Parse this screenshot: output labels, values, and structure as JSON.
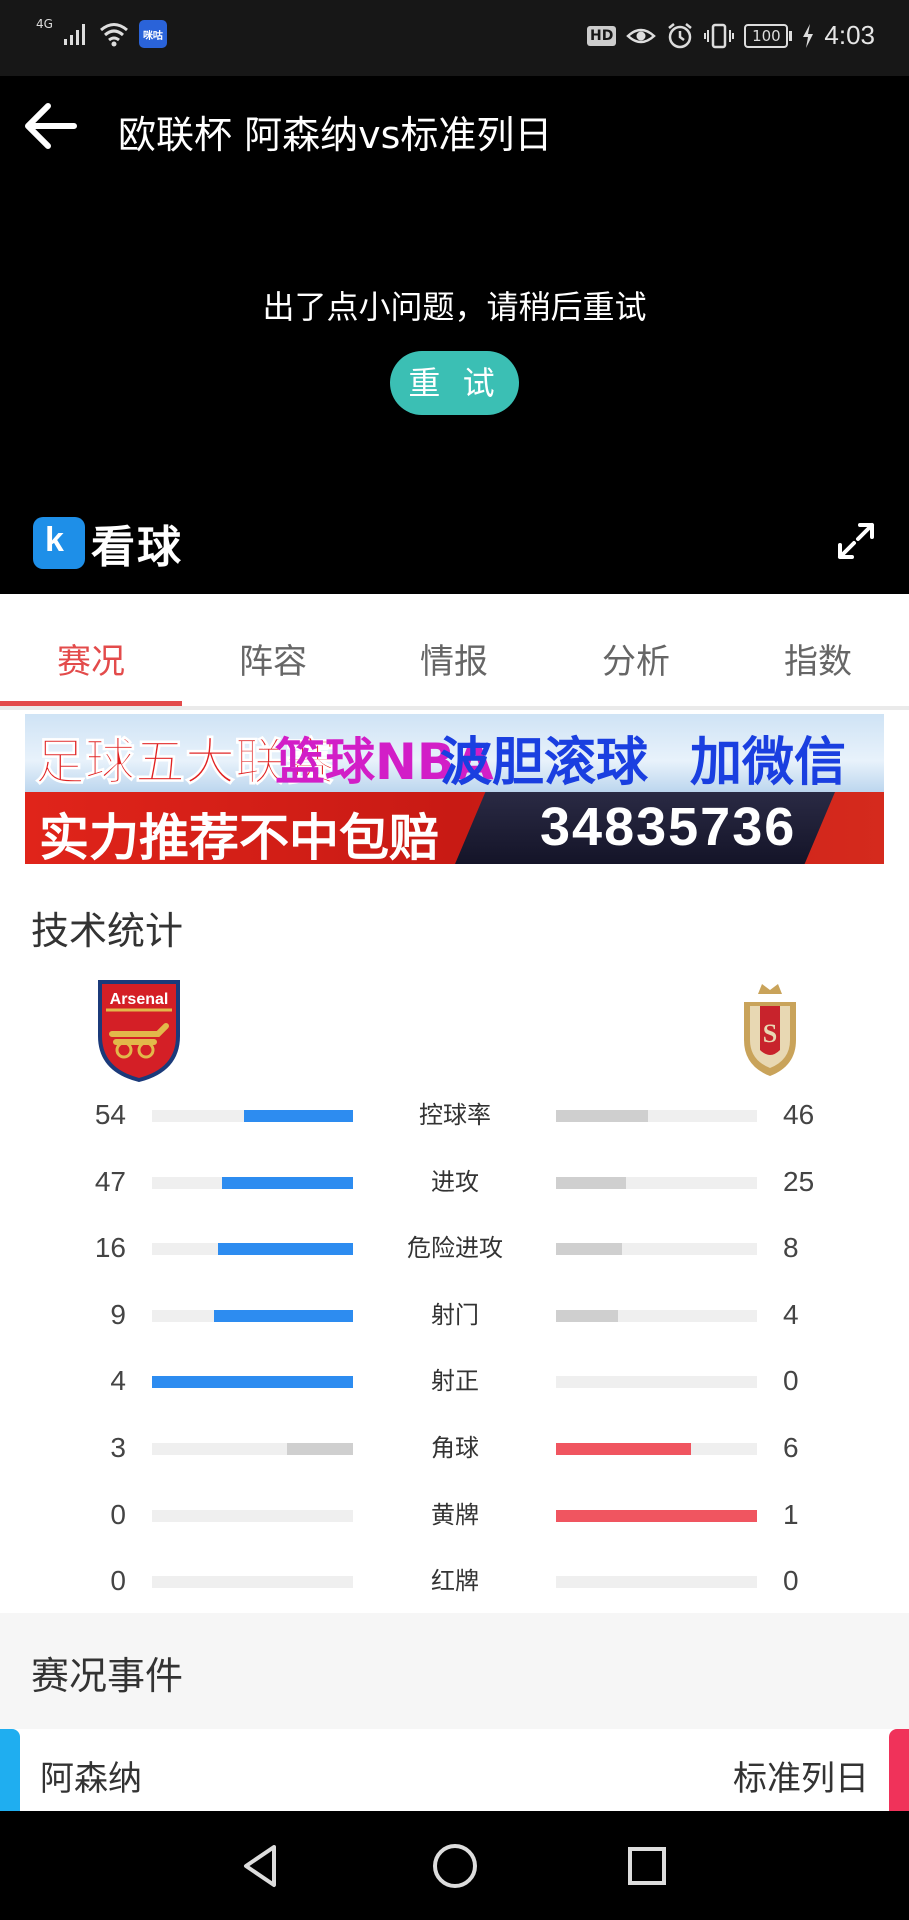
{
  "status_bar": {
    "network_label": "4G",
    "app_badge_text": "咪咕",
    "hd_label": "HD",
    "battery": "100",
    "time": "4:03",
    "icons": [
      "signal-icon",
      "wifi-icon",
      "eye-comfort-icon",
      "alarm-icon",
      "vibrate-icon",
      "battery-icon",
      "charging-icon"
    ]
  },
  "header": {
    "title": "欧联杯 阿森纳vs标准列日"
  },
  "player": {
    "error_message": "出了点小问题，请稍后重试",
    "retry_label": "重 试",
    "logo_text": "看球",
    "retry_color": "#3bbfb4"
  },
  "tabs": [
    {
      "label": "赛况",
      "active": true
    },
    {
      "label": "阵容",
      "active": false
    },
    {
      "label": "情报",
      "active": false
    },
    {
      "label": "分析",
      "active": false
    },
    {
      "label": "指数",
      "active": false
    }
  ],
  "banner": {
    "line1_a": "足球五大联赛",
    "line1_b": "篮球NBA",
    "line1_c": "波胆滚球",
    "line1_d": "加微信",
    "line2_a": "实力推荐不中包赔",
    "line2_b": "34835736"
  },
  "stats": {
    "title": "技术统计",
    "home_color": "#2d8cf0",
    "away_color": "#f05560",
    "neutral_color": "#cfcfcf",
    "rows": [
      {
        "label": "控球率",
        "home": "54",
        "away": "46",
        "home_fill": 0.54,
        "away_fill": 0.46,
        "home_highlight": true,
        "away_highlight": false
      },
      {
        "label": "进攻",
        "home": "47",
        "away": "25",
        "home_fill": 0.65,
        "away_fill": 0.35,
        "home_highlight": true,
        "away_highlight": false
      },
      {
        "label": "危险进攻",
        "home": "16",
        "away": "8",
        "home_fill": 0.67,
        "away_fill": 0.33,
        "home_highlight": true,
        "away_highlight": false
      },
      {
        "label": "射门",
        "home": "9",
        "away": "4",
        "home_fill": 0.69,
        "away_fill": 0.31,
        "home_highlight": true,
        "away_highlight": false
      },
      {
        "label": "射正",
        "home": "4",
        "away": "0",
        "home_fill": 1.0,
        "away_fill": 0.0,
        "home_highlight": true,
        "away_highlight": false
      },
      {
        "label": "角球",
        "home": "3",
        "away": "6",
        "home_fill": 0.33,
        "away_fill": 0.67,
        "home_highlight": false,
        "away_highlight": true
      },
      {
        "label": "黄牌",
        "home": "0",
        "away": "1",
        "home_fill": 0.0,
        "away_fill": 1.0,
        "home_highlight": false,
        "away_highlight": true
      },
      {
        "label": "红牌",
        "home": "0",
        "away": "0",
        "home_fill": 0.0,
        "away_fill": 0.0,
        "home_highlight": false,
        "away_highlight": false
      }
    ]
  },
  "events": {
    "title": "赛况事件",
    "home_team": "阿森纳",
    "away_team": "标准列日",
    "home_color": "#1faef0",
    "away_color": "#f0325a"
  },
  "home_crest": {
    "text": "Arsenal"
  },
  "nav": {
    "buttons": [
      "back-nav-icon",
      "home-nav-icon",
      "recents-nav-icon"
    ]
  }
}
